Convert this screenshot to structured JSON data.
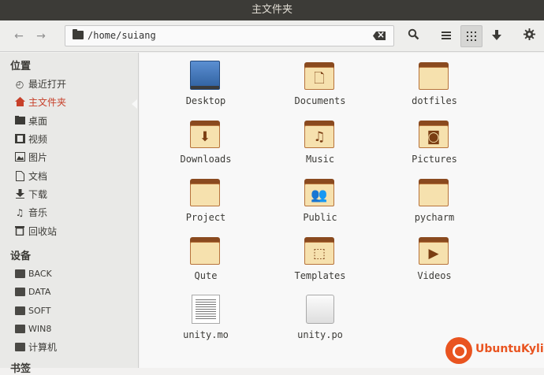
{
  "window": {
    "title": "主文件夹"
  },
  "toolbar": {
    "back_icon": "arrow-left",
    "forward_icon": "arrow-right",
    "path": "/home/suiang",
    "buttons": [
      "search",
      "list-view",
      "grid-view",
      "download",
      "settings"
    ]
  },
  "sidebar": {
    "places_title": "位置",
    "places": [
      {
        "label": "最近打开",
        "icon": "recent-icon"
      },
      {
        "label": "主文件夹",
        "icon": "home-icon",
        "active": true
      },
      {
        "label": "桌面",
        "icon": "desktop-icon"
      },
      {
        "label": "视频",
        "icon": "video-icon"
      },
      {
        "label": "图片",
        "icon": "picture-icon"
      },
      {
        "label": "文档",
        "icon": "document-icon"
      },
      {
        "label": "下载",
        "icon": "download-icon"
      },
      {
        "label": "音乐",
        "icon": "music-icon"
      },
      {
        "label": "回收站",
        "icon": "trash-icon"
      }
    ],
    "devices_title": "设备",
    "devices": [
      {
        "label": "BACK"
      },
      {
        "label": "DATA"
      },
      {
        "label": "SOFT"
      },
      {
        "label": "WIN8"
      },
      {
        "label": "计算机"
      }
    ],
    "bookmarks_title": "书签"
  },
  "files": [
    {
      "name": "Desktop",
      "type": "desktop"
    },
    {
      "name": "Documents",
      "type": "folder",
      "glyph": "document"
    },
    {
      "name": "dotfiles",
      "type": "folder"
    },
    {
      "name": "Downloads",
      "type": "folder",
      "glyph": "download"
    },
    {
      "name": "Music",
      "type": "folder",
      "glyph": "music"
    },
    {
      "name": "Pictures",
      "type": "folder",
      "glyph": "camera"
    },
    {
      "name": "Project",
      "type": "folder"
    },
    {
      "name": "Public",
      "type": "folder",
      "glyph": "people"
    },
    {
      "name": "pycharm",
      "type": "folder"
    },
    {
      "name": "Qute",
      "type": "folder"
    },
    {
      "name": "Templates",
      "type": "folder",
      "glyph": "template"
    },
    {
      "name": "Videos",
      "type": "folder",
      "glyph": "video"
    },
    {
      "name": "unity.mo",
      "type": "binary-file"
    },
    {
      "name": "unity.po",
      "type": "text-file"
    }
  ],
  "watermark": {
    "text": "UbuntuKylin",
    "color": "#e95420"
  },
  "colors": {
    "titlebar": "#3c3b37",
    "accent": "#c7402a",
    "folder": "#f6e1ae"
  }
}
